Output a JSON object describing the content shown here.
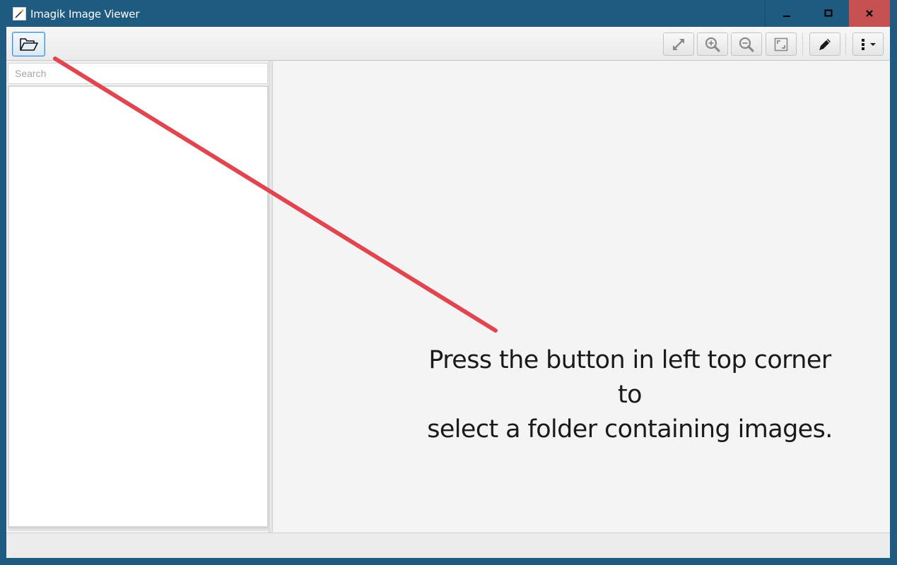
{
  "window": {
    "title": "Imagik Image Viewer",
    "controls": [
      "minimize-icon",
      "maximize-icon",
      "close-icon"
    ],
    "close_color": "#c75050",
    "titlebar_color": "#1f5a80"
  },
  "toolbar": {
    "open_folder_icon": "folder-open-icon",
    "right_buttons": [
      "fullscreen-icon",
      "zoom-in-icon",
      "zoom-out-icon",
      "fit-to-window-icon",
      "edit-pencil-icon",
      "more-options-icon"
    ]
  },
  "sidebar": {
    "search_placeholder": "Search"
  },
  "viewer": {
    "hint_line1": "Press the button in left top corner to",
    "hint_line2": "select a folder containing images."
  },
  "annotation": {
    "arrow_color": "#e04550"
  }
}
